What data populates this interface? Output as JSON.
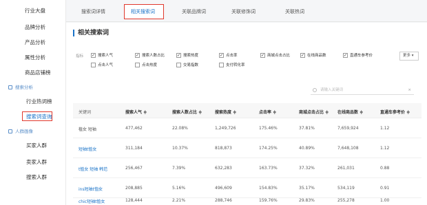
{
  "sidebar": {
    "items_top": [
      "行业大盘",
      "品牌分析",
      "产品分析",
      "属性分析",
      "商品店铺榜"
    ],
    "group1": "搜索分析",
    "group1_items": [
      "行业热词榜",
      "搜索词查询"
    ],
    "group2": "人群画像",
    "group2_items": [
      "买家人群",
      "卖家人群",
      "搜索人群"
    ]
  },
  "tabs": [
    "搜索词详情",
    "相关搜索词",
    "关联品牌词",
    "关联修饰词",
    "关联热词"
  ],
  "active_tab": 1,
  "panel_title": "相关搜索词",
  "filter": {
    "label": "指标",
    "row1": [
      {
        "label": "搜索人气",
        "checked": true
      },
      {
        "label": "搜索人数占比",
        "checked": true
      },
      {
        "label": "搜索热度",
        "checked": true
      },
      {
        "label": "点击率",
        "checked": true
      },
      {
        "label": "商城点击占比",
        "checked": true
      },
      {
        "label": "在线商品数",
        "checked": true
      },
      {
        "label": "直通车参考价",
        "checked": true
      }
    ],
    "row2": [
      {
        "label": "点击人气",
        "checked": false
      },
      {
        "label": "点击热度",
        "checked": false
      },
      {
        "label": "交易指数",
        "checked": false
      },
      {
        "label": "支付转化率",
        "checked": false
      }
    ],
    "more": "更多"
  },
  "search_placeholder": "请输入关键词",
  "table": {
    "headers": [
      "关键词",
      "搜索人气 ≑",
      "搜索人数占比 ≑",
      "搜索热度 ≑",
      "点击率 ≑",
      "商城点击占比 ≑",
      "在线商品数 ≑",
      "直通车参考价 ≑"
    ],
    "rows": [
      [
        "植女 短袖",
        "477,462",
        "22.08%",
        "1,249,726",
        "175.46%",
        "37.81%",
        "7,659,924",
        "1.12"
      ],
      [
        "短袖t恤女",
        "311,184",
        "10.37%",
        "818,873",
        "174.25%",
        "40.89%",
        "7,648,108",
        "1.12"
      ],
      [
        "t恤女 短袖 韩范",
        "256,467",
        "7.39%",
        "632,283",
        "163.73%",
        "37.32%",
        "261,031",
        "0.88"
      ],
      [
        "ins短袖t恤女",
        "208,885",
        "5.16%",
        "496,609",
        "154.83%",
        "35.17%",
        "534,119",
        "0.91"
      ],
      [
        "chic短袖t恤女",
        "128,444",
        "2.21%",
        "288,746",
        "159.76%",
        "29.83%",
        "255,278",
        "1.00"
      ]
    ]
  },
  "colors": {
    "accent": "#1a73c8",
    "highlight": "#e0372b"
  }
}
